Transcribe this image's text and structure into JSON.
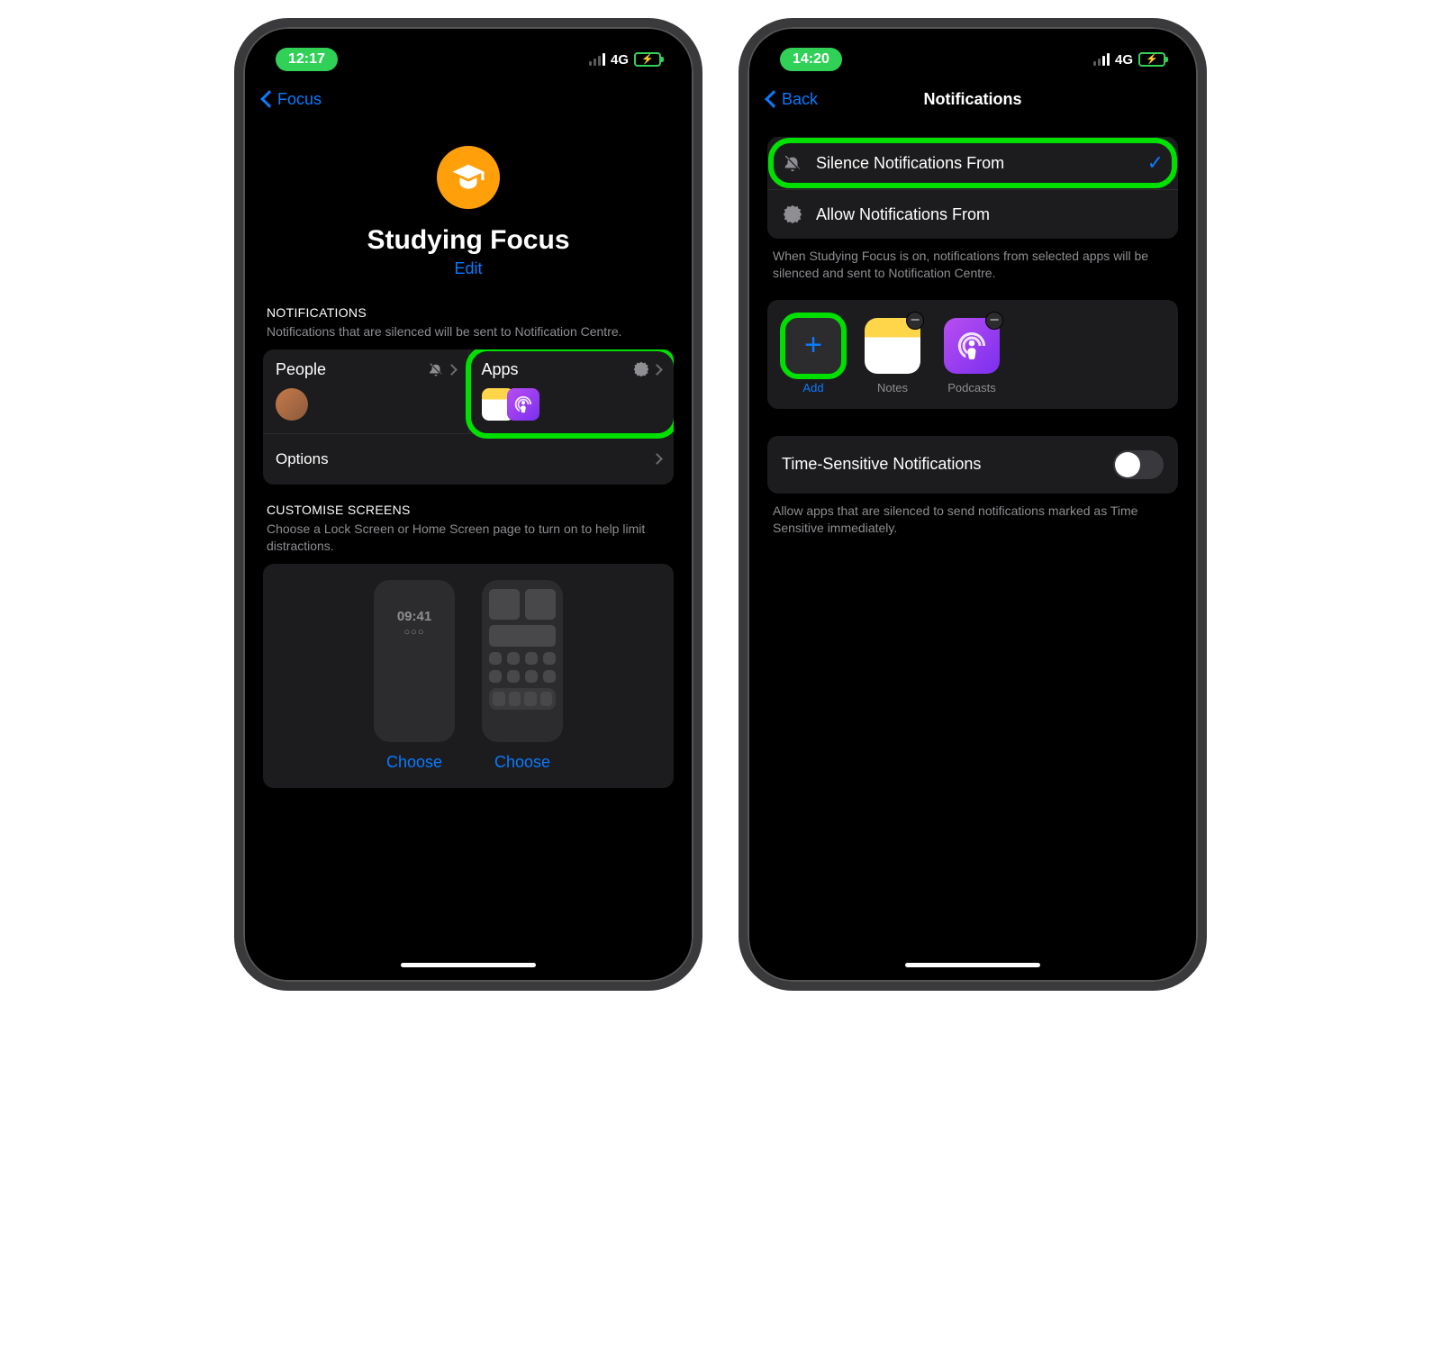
{
  "colors": {
    "accent": "#0a7aff",
    "highlight": "#00e000",
    "focus_badge": "#ff9f0a"
  },
  "phone1": {
    "status": {
      "time": "12:17",
      "network": "4G"
    },
    "nav": {
      "back": "Focus"
    },
    "hero": {
      "title": "Studying Focus",
      "edit": "Edit",
      "icon_name": "graduation-cap"
    },
    "notifications": {
      "header": "NOTIFICATIONS",
      "sub": "Notifications that are silenced will be sent to Notification Centre.",
      "people": {
        "label": "People",
        "state_icon": "bell-slash"
      },
      "apps": {
        "label": "Apps",
        "state_icon": "verified",
        "apps": [
          "Notes",
          "Podcasts"
        ]
      },
      "options": "Options"
    },
    "screens": {
      "header": "CUSTOMISE SCREENS",
      "sub": "Choose a Lock Screen or Home Screen page to turn on to help limit distractions.",
      "lock_time": "09:41",
      "choose": "Choose"
    }
  },
  "phone2": {
    "status": {
      "time": "14:20",
      "network": "4G"
    },
    "nav": {
      "back": "Back",
      "title": "Notifications"
    },
    "modes": [
      {
        "icon": "bell-slash",
        "label": "Silence Notifications From",
        "selected": true
      },
      {
        "icon": "check-seal",
        "label": "Allow Notifications From",
        "selected": false
      }
    ],
    "modes_sub": "When Studying Focus is on, notifications from selected apps will be silenced and sent to Notification Centre.",
    "apps": {
      "add_label": "Add",
      "tiles": [
        {
          "name": "Notes"
        },
        {
          "name": "Podcasts"
        }
      ]
    },
    "time_sensitive": {
      "label": "Time-Sensitive Notifications",
      "on": false,
      "sub": "Allow apps that are silenced to send notifications marked as Time Sensitive immediately."
    }
  }
}
